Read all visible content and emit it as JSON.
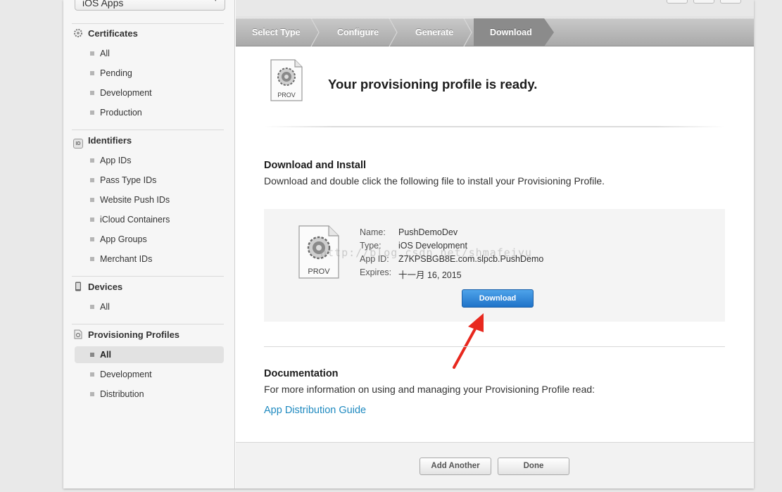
{
  "sidebar": {
    "app_select": "iOS Apps",
    "sections": [
      {
        "title": "Certificates",
        "icon": "gear-certificate-icon",
        "items": [
          "All",
          "Pending",
          "Development",
          "Production"
        ]
      },
      {
        "title": "Identifiers",
        "icon": "id-badge-icon",
        "items": [
          "App IDs",
          "Pass Type IDs",
          "Website Push IDs",
          "iCloud Containers",
          "App Groups",
          "Merchant IDs"
        ]
      },
      {
        "title": "Devices",
        "icon": "device-icon",
        "items": [
          "All"
        ]
      },
      {
        "title": "Provisioning Profiles",
        "icon": "provisioning-profile-icon",
        "items": [
          "All",
          "Development",
          "Distribution"
        ],
        "active_index": 0
      }
    ]
  },
  "steps": [
    "Select Type",
    "Configure",
    "Generate",
    "Download"
  ],
  "main": {
    "icon_label": "PROV",
    "ready_title": "Your provisioning profile is ready.",
    "download_install_title": "Download and Install",
    "download_install_text": "Download and double click the following file to install your Provisioning Profile.",
    "profile": {
      "name_label": "Name:",
      "name": "PushDemoDev",
      "type_label": "Type:",
      "type": "iOS Development",
      "appid_label": "App ID:",
      "appid": "Z7KPSBGB8E.com.slpcb.PushDemo",
      "expires_label": "Expires:",
      "expires": "十一月 16, 2015"
    },
    "download_button": "Download",
    "watermark": "http://blog.csdn.net/shmafeiyu",
    "documentation_title": "Documentation",
    "documentation_text": "For more information on using and managing your Provisioning Profile read:",
    "documentation_link": "App Distribution Guide"
  },
  "footer": {
    "add_another": "Add Another",
    "done": "Done"
  },
  "colors": {
    "accent_blue": "#1f73c9",
    "link": "#1f8ac0",
    "annotation_arrow": "#e8281e"
  }
}
